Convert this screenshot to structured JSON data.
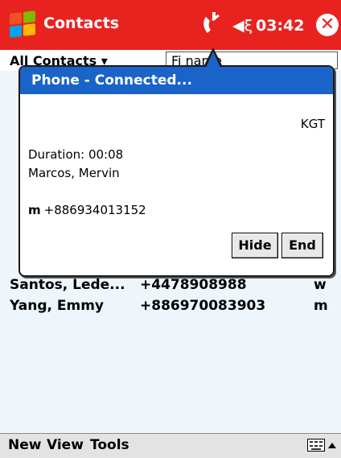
{
  "titlebar": {
    "title": "Contacts",
    "time": "03:42",
    "close_glyph": "✕",
    "start_icon": "windows-start-icon",
    "phone_icon": "phone-active-icon",
    "volume_icon": "speaker-icon",
    "color": "#e8231f"
  },
  "filter": {
    "category": "All Contacts",
    "find_value": "Fi   name"
  },
  "contacts": [
    {
      "name": "Santos, Lede...",
      "phone": "+4478908988",
      "type": "w"
    },
    {
      "name": "Yang, Emmy",
      "phone": "+886970083903",
      "type": "m"
    }
  ],
  "popup": {
    "title": "Phone - Connected...",
    "carrier": "KGT",
    "duration": "Duration: 00:08",
    "contact_name": "Marcos, Mervin",
    "number_type": "m",
    "number": "+886934013152",
    "hide_label": "Hide",
    "end_label": "End",
    "header_color": "#1a63c8"
  },
  "menubar": {
    "new": "New",
    "view": "View",
    "tools": "Tools",
    "keyboard_icon": "keyboard-icon",
    "arrow_icon": "up-arrow-icon"
  }
}
